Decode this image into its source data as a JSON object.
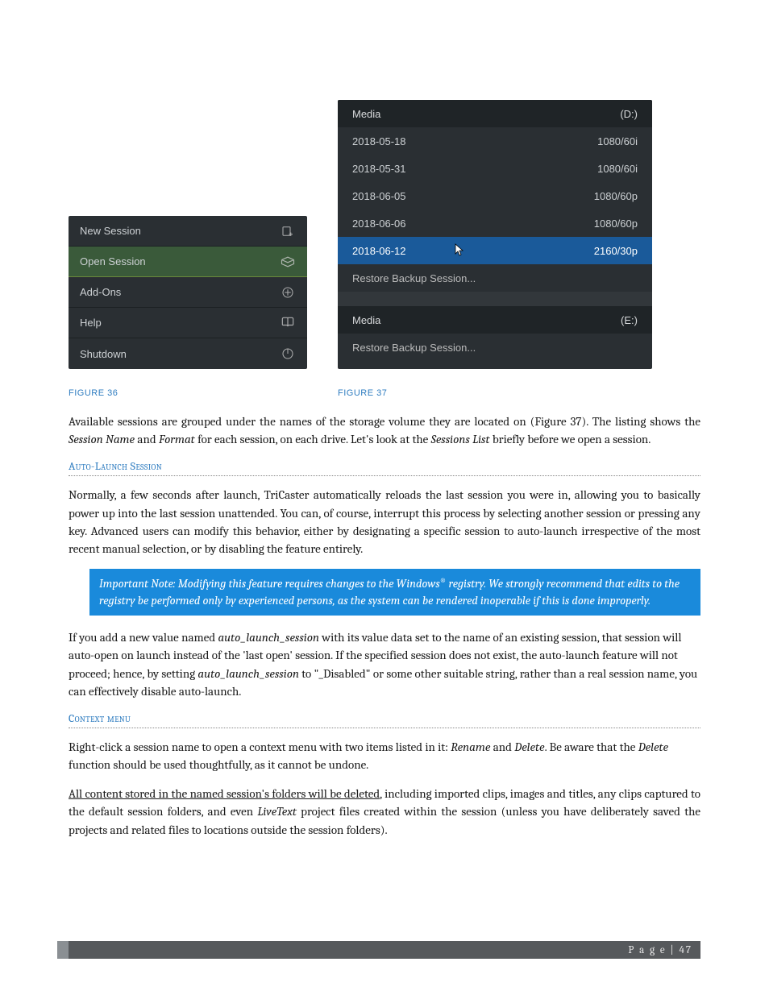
{
  "menu": {
    "items": [
      {
        "label": "New Session",
        "icon": "new-session-icon"
      },
      {
        "label": "Open Session",
        "icon": "open-session-icon"
      },
      {
        "label": "Add-Ons",
        "icon": "addons-icon"
      },
      {
        "label": "Help",
        "icon": "help-icon"
      },
      {
        "label": "Shutdown",
        "icon": "shutdown-icon"
      }
    ]
  },
  "sessions": {
    "volumes": [
      {
        "header_left": "Media",
        "header_right": "(D:)",
        "rows": [
          {
            "name": "2018-05-18",
            "format": "1080/60i"
          },
          {
            "name": "2018-05-31",
            "format": "1080/60i"
          },
          {
            "name": "2018-06-05",
            "format": "1080/60p"
          },
          {
            "name": "2018-06-06",
            "format": "1080/60p"
          },
          {
            "name": "2018-06-12",
            "format": "2160/30p"
          }
        ],
        "restore": "Restore Backup Session..."
      },
      {
        "header_left": "Media",
        "header_right": "(E:)",
        "rows": [],
        "restore": "Restore Backup Session..."
      }
    ]
  },
  "captions": {
    "fig36": "FIGURE 36",
    "fig37": "FIGURE 37"
  },
  "paragraphs": {
    "p1a": "Available sessions are grouped under the names of the storage volume they are located on (Figure 37). The listing shows the ",
    "p1b": "Session Name",
    "p1c": " and ",
    "p1d": "Format",
    "p1e": " for each session, on each drive.  Let's look at the ",
    "p1f": "Sessions List",
    "p1g": " briefly before we open a session.",
    "h1": "Auto-Launch Session",
    "p2": "Normally, a few seconds after launch, TriCaster automatically reloads the last session you were in, allowing you to basically power up into the last session unattended.  You can, of course, interrupt this process by selecting another session or pressing any key. Advanced users can modify this behavior, either by designating a specific session to auto-launch irrespective of the most recent manual selection, or by disabling the feature entirely.",
    "note_a": "Important Note: Modifying this feature requires changes to the Windows",
    "note_b": " registry.  We strongly recommend that edits to the registry be performed only by experienced persons, as the system can be rendered inoperable if this is done improperly.",
    "p3a": "If you add a new value named ",
    "p3b": "auto_launch_session",
    "p3c": " with its value data set to the name of an existing session, that session will auto-open on launch instead of the 'last open' session.  If the specified session does not exist, the auto-launch feature will not proceed; hence, by setting ",
    "p3d": "auto_launch_session",
    "p3e": " to \"_Disabled\" or some other suitable string, rather than a real session name, you can effectively disable auto-launch.",
    "h2": "Context menu",
    "p4a": "Right-click a session name to open a context menu with two items listed in it: ",
    "p4b": "Rename",
    "p4c": " and ",
    "p4d": "Delete",
    "p4e": ".   Be aware that the ",
    "p4f": "Delete",
    "p4g": " function should be used thoughtfully, as it cannot be undone.",
    "p5a": "All content stored in the named session's folders will be deleted",
    "p5b": ", including imported clips, images and titles, any clips captured to the default session folders, and even ",
    "p5c": "LiveText",
    "p5d": " project files created within the session (unless you have deliberately saved the projects and related files to locations outside the session folders)."
  },
  "footer": {
    "label": "P a g e  | 47"
  }
}
